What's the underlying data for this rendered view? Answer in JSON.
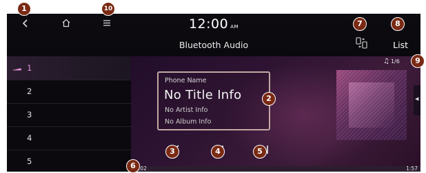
{
  "header": {
    "clock": "12:00",
    "ampm": "AM",
    "subtitle": "Bluetooth Audio",
    "list_label": "List"
  },
  "icons": {
    "back": "back-chevron",
    "home": "home",
    "menu": "menu",
    "change_source": "phone-change"
  },
  "sidebar": {
    "items": [
      {
        "label": "1",
        "active": true
      },
      {
        "label": "2",
        "active": false
      },
      {
        "label": "3",
        "active": false
      },
      {
        "label": "4",
        "active": false
      },
      {
        "label": "5",
        "active": false
      }
    ]
  },
  "player": {
    "phone_name": "Phone Name",
    "title": "No Title Info",
    "artist": "No Artist Info",
    "album": "No Album Info",
    "track_position": "1/6",
    "elapsed": "0:02",
    "duration": "1:57",
    "progress_fraction": 0.02
  },
  "callouts": [
    "1",
    "2",
    "3",
    "4",
    "5",
    "6",
    "7",
    "8",
    "9",
    "10"
  ],
  "colors": {
    "accent": "#8e3b7e",
    "active_track": "#e18fd1",
    "callout_bg": "#7a2a14"
  }
}
